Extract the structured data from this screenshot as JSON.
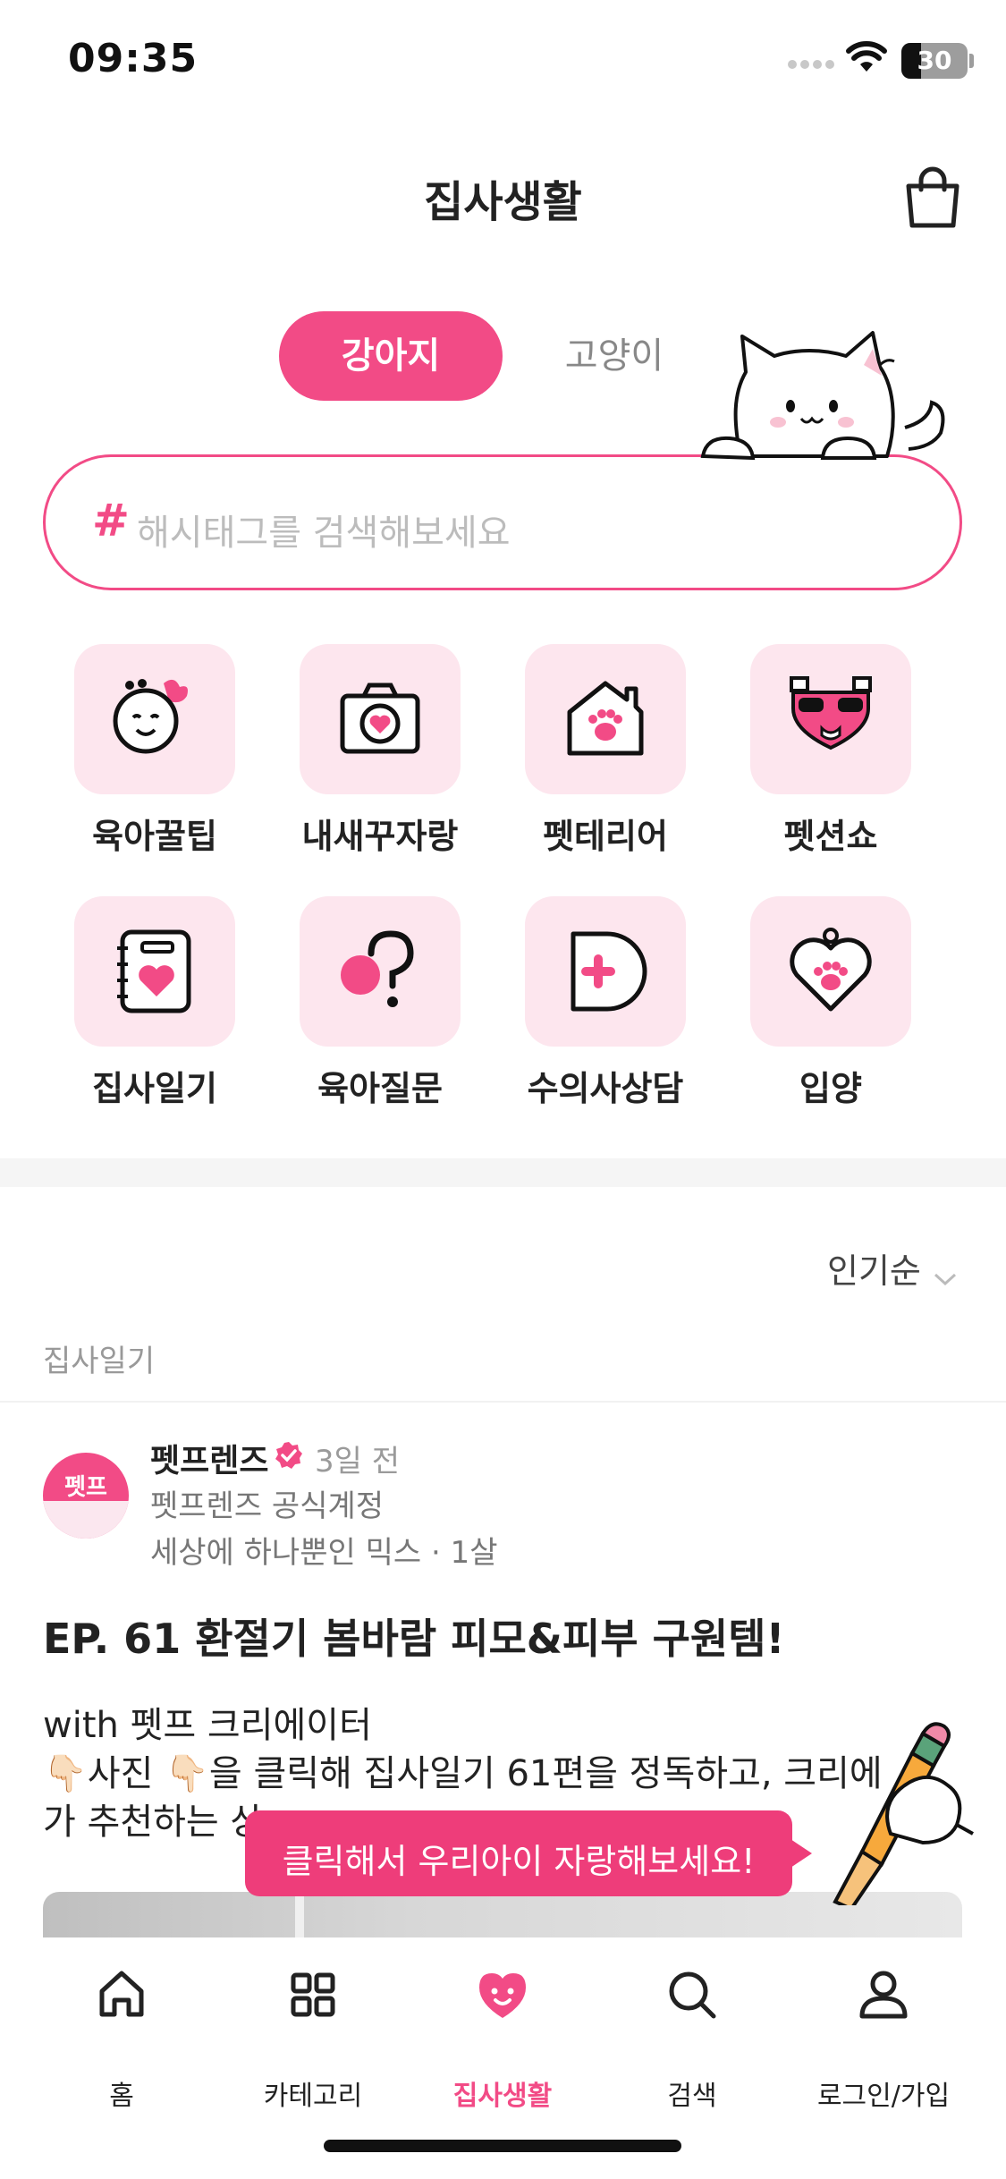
{
  "status_bar": {
    "time": "09:35",
    "battery": "30",
    "battery_percent": 30
  },
  "header": {
    "title": "집사생활",
    "cart_icon": "shopping-bag-icon"
  },
  "pet_tabs": [
    {
      "label": "강아지",
      "active": true
    },
    {
      "label": "고양이",
      "active": false
    }
  ],
  "search": {
    "hash_symbol": "#",
    "placeholder": "해시태그를 검색해보세요"
  },
  "categories": [
    {
      "label": "육아꿀팁",
      "icon": "baby-face-icon"
    },
    {
      "label": "내새꾸자랑",
      "icon": "camera-heart-icon"
    },
    {
      "label": "펫테리어",
      "icon": "house-paw-icon"
    },
    {
      "label": "펫션쇼",
      "icon": "sunglasses-dog-icon"
    },
    {
      "label": "집사일기",
      "icon": "notebook-heart-icon"
    },
    {
      "label": "육아질문",
      "icon": "question-icon"
    },
    {
      "label": "수의사상담",
      "icon": "medical-cross-icon"
    },
    {
      "label": "입양",
      "icon": "heart-tag-paw-icon"
    }
  ],
  "feed": {
    "sort_label": "인기순",
    "section_label": "집사일기",
    "post": {
      "avatar_text": "펫프",
      "author": "펫프렌즈",
      "time": "3일 전",
      "author_sub": "펫프렌즈 공식계정",
      "pet_meta": "세상에 하나뿐인 믹스 · 1살",
      "title": "EP. 61 환절기 봄바람 피모&피부 구원템!",
      "body_line1": "with 펫프 크리에이터",
      "body_line2": "👇🏻사진 👇🏻을 클릭해 집사일기 61편을 정독하고, 크리에",
      "body_line3": "가 추천하는 상"
    }
  },
  "tooltip": {
    "text": "클릭해서 우리아이 자랑해보세요!"
  },
  "bottom_nav": [
    {
      "label": "홈",
      "icon": "home-icon",
      "active": false
    },
    {
      "label": "카테고리",
      "icon": "grid-icon",
      "active": false
    },
    {
      "label": "집사생활",
      "icon": "heart-face-icon",
      "active": true
    },
    {
      "label": "검색",
      "icon": "search-icon",
      "active": false
    },
    {
      "label": "로그인/가입",
      "icon": "user-icon",
      "active": false
    }
  ],
  "colors": {
    "accent": "#f24b86",
    "icon_bg": "#fde6ee",
    "tooltip": "#ee3d7a"
  }
}
